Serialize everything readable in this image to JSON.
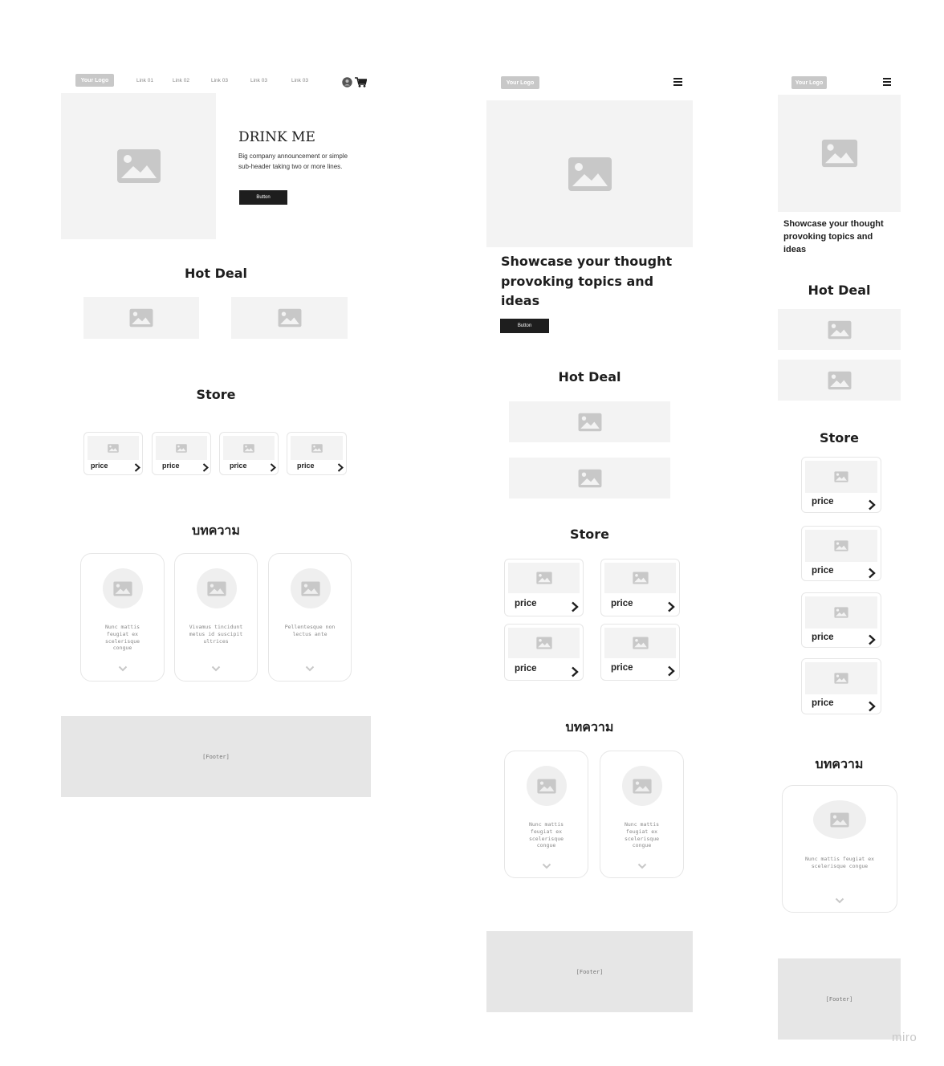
{
  "nav": {
    "logo": "Your Logo",
    "links": [
      "Link 01",
      "Link 02",
      "Link 03",
      "Link 03",
      "Link 03"
    ]
  },
  "hero": {
    "title": "DRINK ME",
    "subtitle": "Big company announcement or simple sub-header taking two or more lines.",
    "button": "Button"
  },
  "showcase": "Showcase your thought provoking topics and ideas",
  "sections": {
    "hot_deal": "Hot Deal",
    "store": "Store",
    "articles": "บทความ"
  },
  "store": {
    "price_label": "price"
  },
  "articles": [
    "Nunc mattis feugiat ex scelerisque congue",
    "Vivamus tincidunt metus id suscipit ultrices",
    "Pellentesque non lectus ante"
  ],
  "footer": "[Footer]",
  "watermark": "miro",
  "icons": {
    "image": "image-placeholder-icon",
    "cart": "shopping-cart-icon",
    "user": "user-circle-icon",
    "arrow": "chevron-right-icon",
    "chevron": "chevron-down-icon",
    "menu": "hamburger-menu-icon"
  }
}
